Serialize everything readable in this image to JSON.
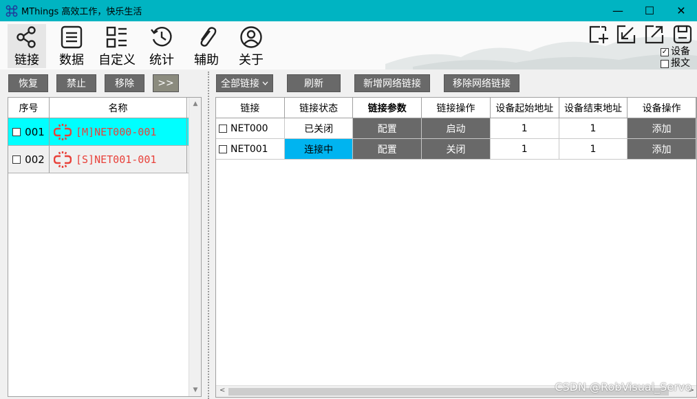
{
  "window": {
    "title": "MThings  高效工作，快乐生活",
    "minimize": "—",
    "maximize": "☐",
    "close": "✕"
  },
  "toolbar": {
    "items": [
      {
        "label": "链接",
        "icon": "share-icon"
      },
      {
        "label": "数据",
        "icon": "list-icon"
      },
      {
        "label": "自定义",
        "icon": "grid-icon"
      },
      {
        "label": "统计",
        "icon": "history-icon"
      },
      {
        "label": "辅助",
        "icon": "paperclip-icon"
      },
      {
        "label": "关于",
        "icon": "user-icon"
      }
    ],
    "right_icons": [
      "add-window-icon",
      "shrink-icon",
      "expand-icon",
      "save-icon"
    ],
    "checks": [
      {
        "label": "设备",
        "checked": true
      },
      {
        "label": "报文",
        "checked": false
      }
    ]
  },
  "left": {
    "buttons": [
      "恢复",
      "禁止",
      "移除",
      ">>"
    ],
    "headers": [
      "序号",
      "名称"
    ],
    "rows": [
      {
        "index": "001",
        "name": "[M]NET000-001",
        "selected": true
      },
      {
        "index": "002",
        "name": "[S]NET001-001",
        "selected": false
      }
    ]
  },
  "right": {
    "filter_label": "全部链接",
    "buttons": [
      "刷新",
      "新增网络链接",
      "移除网络链接"
    ],
    "headers": [
      "链接",
      "链接状态",
      "链接参数",
      "链接操作",
      "设备起始地址",
      "设备结束地址",
      "设备操作"
    ],
    "rows": [
      {
        "name": "NET000",
        "status": "已关闭",
        "param": "配置",
        "op": "启动",
        "start": "1",
        "end": "1",
        "dev_op": "添加",
        "active": false
      },
      {
        "name": "NET001",
        "status": "连接中",
        "param": "配置",
        "op": "关闭",
        "start": "1",
        "end": "1",
        "dev_op": "添加",
        "active": true
      }
    ]
  },
  "watermark": "CSDN @RobVisual_Servo",
  "colors": {
    "titlebar": "#00b4c2",
    "selected_row": "#00ffff",
    "status_active": "#00b4f0",
    "button": "#696969",
    "link_red": "#e8413a"
  }
}
